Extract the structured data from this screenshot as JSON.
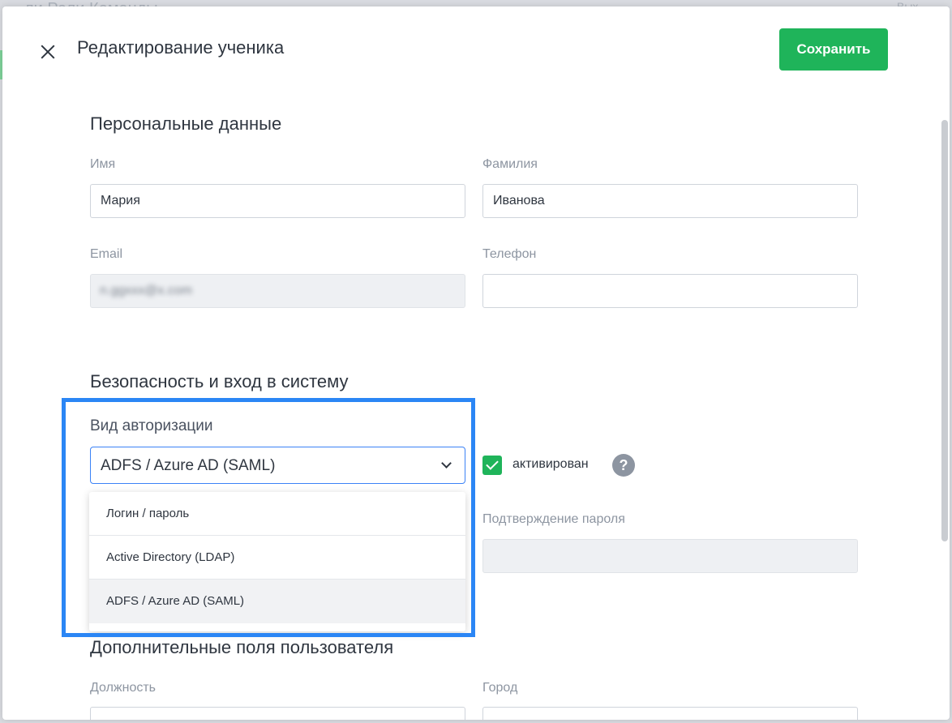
{
  "background": {
    "tabs_text": "ли   Роли   Команды",
    "right_text": "Вых"
  },
  "header": {
    "title": "Редактирование ученика",
    "save_label": "Сохранить"
  },
  "personal": {
    "title": "Персональные данные",
    "first_name_label": "Имя",
    "first_name_value": "Мария",
    "last_name_label": "Фамилия",
    "last_name_value": "Иванова",
    "email_label": "Email",
    "email_value": "n.ggxxx@x.com",
    "phone_label": "Телефон",
    "phone_value": ""
  },
  "security": {
    "title": "Безопасность и вход в систему",
    "auth_type_label": "Вид авторизации",
    "auth_type_value": "ADFS / Azure AD (SAML)",
    "activated_label": "активирован",
    "activated": true,
    "help_symbol": "?",
    "password_confirm_label": "Подтверждение пароля",
    "password_confirm_value": ""
  },
  "auth_options": [
    {
      "label": "Логин / пароль",
      "selected": false
    },
    {
      "label": "Active Directory (LDAP)",
      "selected": false
    },
    {
      "label": "ADFS / Azure AD (SAML)",
      "selected": true
    }
  ],
  "extra": {
    "title": "Дополнительные поля пользователя",
    "position_label": "Должность",
    "city_label": "Город"
  },
  "colors": {
    "accent_green": "#1fb45a",
    "highlight_blue": "#2b86f5",
    "select_border": "#3b82f6"
  }
}
